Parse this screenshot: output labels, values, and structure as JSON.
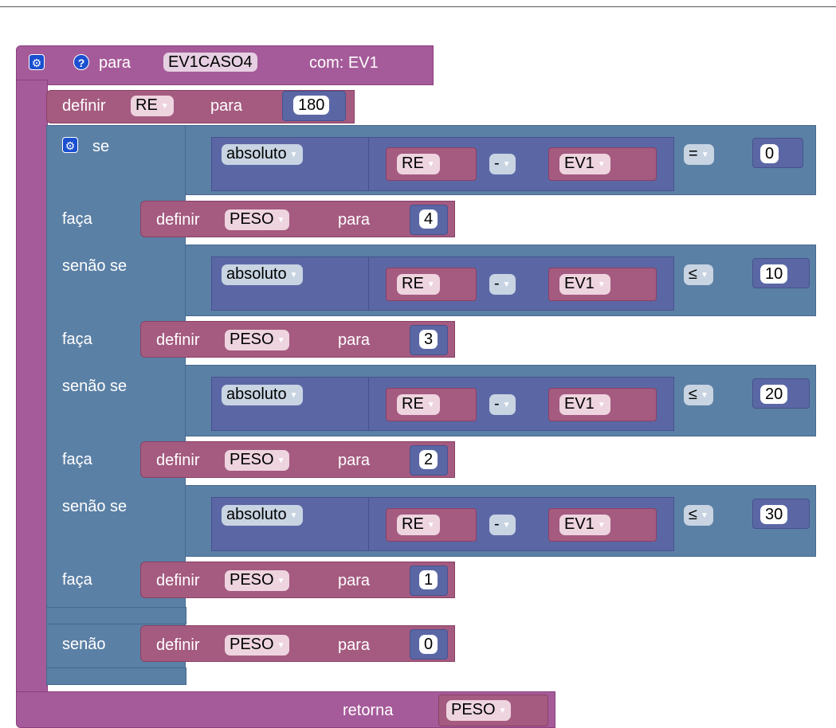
{
  "procedure": {
    "keyword": "para",
    "name": "EV1CASO4",
    "params_label": "com: EV1",
    "return_label": "retorna",
    "return_var": "PESO"
  },
  "initial_set": {
    "keyword": "definir",
    "var": "RE",
    "connector": "para",
    "value": "180"
  },
  "if_block": {
    "if_label": "se",
    "do_label": "faça",
    "elseif_label": "senão se",
    "else_label": "senão",
    "branches": [
      {
        "abs_label": "absoluto",
        "left_var": "RE",
        "op": "-",
        "right_var": "EV1",
        "compare_op": "=",
        "compare_value": "0",
        "set_keyword": "definir",
        "set_var": "PESO",
        "set_connector": "para",
        "set_value": "4"
      },
      {
        "abs_label": "absoluto",
        "left_var": "RE",
        "op": "-",
        "right_var": "EV1",
        "compare_op": "≤",
        "compare_value": "10",
        "set_keyword": "definir",
        "set_var": "PESO",
        "set_connector": "para",
        "set_value": "3"
      },
      {
        "abs_label": "absoluto",
        "left_var": "RE",
        "op": "-",
        "right_var": "EV1",
        "compare_op": "≤",
        "compare_value": "20",
        "set_keyword": "definir",
        "set_var": "PESO",
        "set_connector": "para",
        "set_value": "2"
      },
      {
        "abs_label": "absoluto",
        "left_var": "RE",
        "op": "-",
        "right_var": "EV1",
        "compare_op": "≤",
        "compare_value": "30",
        "set_keyword": "definir",
        "set_var": "PESO",
        "set_connector": "para",
        "set_value": "1"
      }
    ],
    "else_set": {
      "set_keyword": "definir",
      "set_var": "PESO",
      "set_connector": "para",
      "set_value": "0"
    }
  }
}
